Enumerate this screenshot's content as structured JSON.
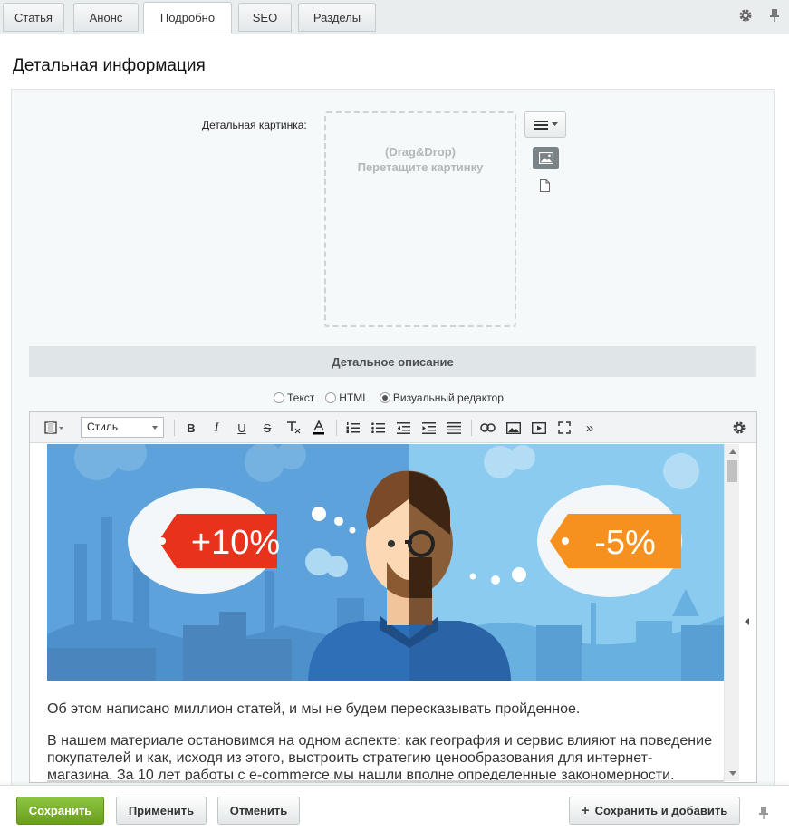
{
  "tabs": [
    {
      "label": "Статья",
      "active": false
    },
    {
      "label": "Анонс",
      "active": false
    },
    {
      "label": "Подробно",
      "active": true
    },
    {
      "label": "SEO",
      "active": false
    },
    {
      "label": "Разделы",
      "active": false
    }
  ],
  "page_title": "Детальная информация",
  "picture_field": {
    "label": "Детальная картинка:",
    "drop_hint_1": "(Drag&Drop)",
    "drop_hint_2": "Перетащите картинку"
  },
  "description_section": {
    "title": "Детальное описание",
    "modes": [
      {
        "label": "Текст",
        "selected": false
      },
      {
        "label": "HTML",
        "selected": false
      },
      {
        "label": "Визуальный редактор",
        "selected": true
      }
    ]
  },
  "editor": {
    "style_select": "Стиль",
    "hero_badges": {
      "left": "+10%",
      "right": "-5%"
    },
    "paragraph_1": "Об этом написано миллион статей, и мы не будем пересказывать пройденное.",
    "paragraph_2": "В нашем материале остановимся на одном аспекте: как география и сервис влияют на поведение покупателей и как, исходя из этого, выстроить стратегию ценообразования для интернет-магазина. За 10 лет работы с e-commerce мы нашли вполне определенные закономерности."
  },
  "footer": {
    "save": "Сохранить",
    "apply": "Применить",
    "cancel": "Отменить",
    "save_and_add": "Сохранить и добавить"
  },
  "colors": {
    "save_green": "#7db32e",
    "badge_red": "#e8321c",
    "badge_orange": "#f6901e",
    "sky_left": "#5fa4dc",
    "sky_right": "#8ccdf0"
  }
}
